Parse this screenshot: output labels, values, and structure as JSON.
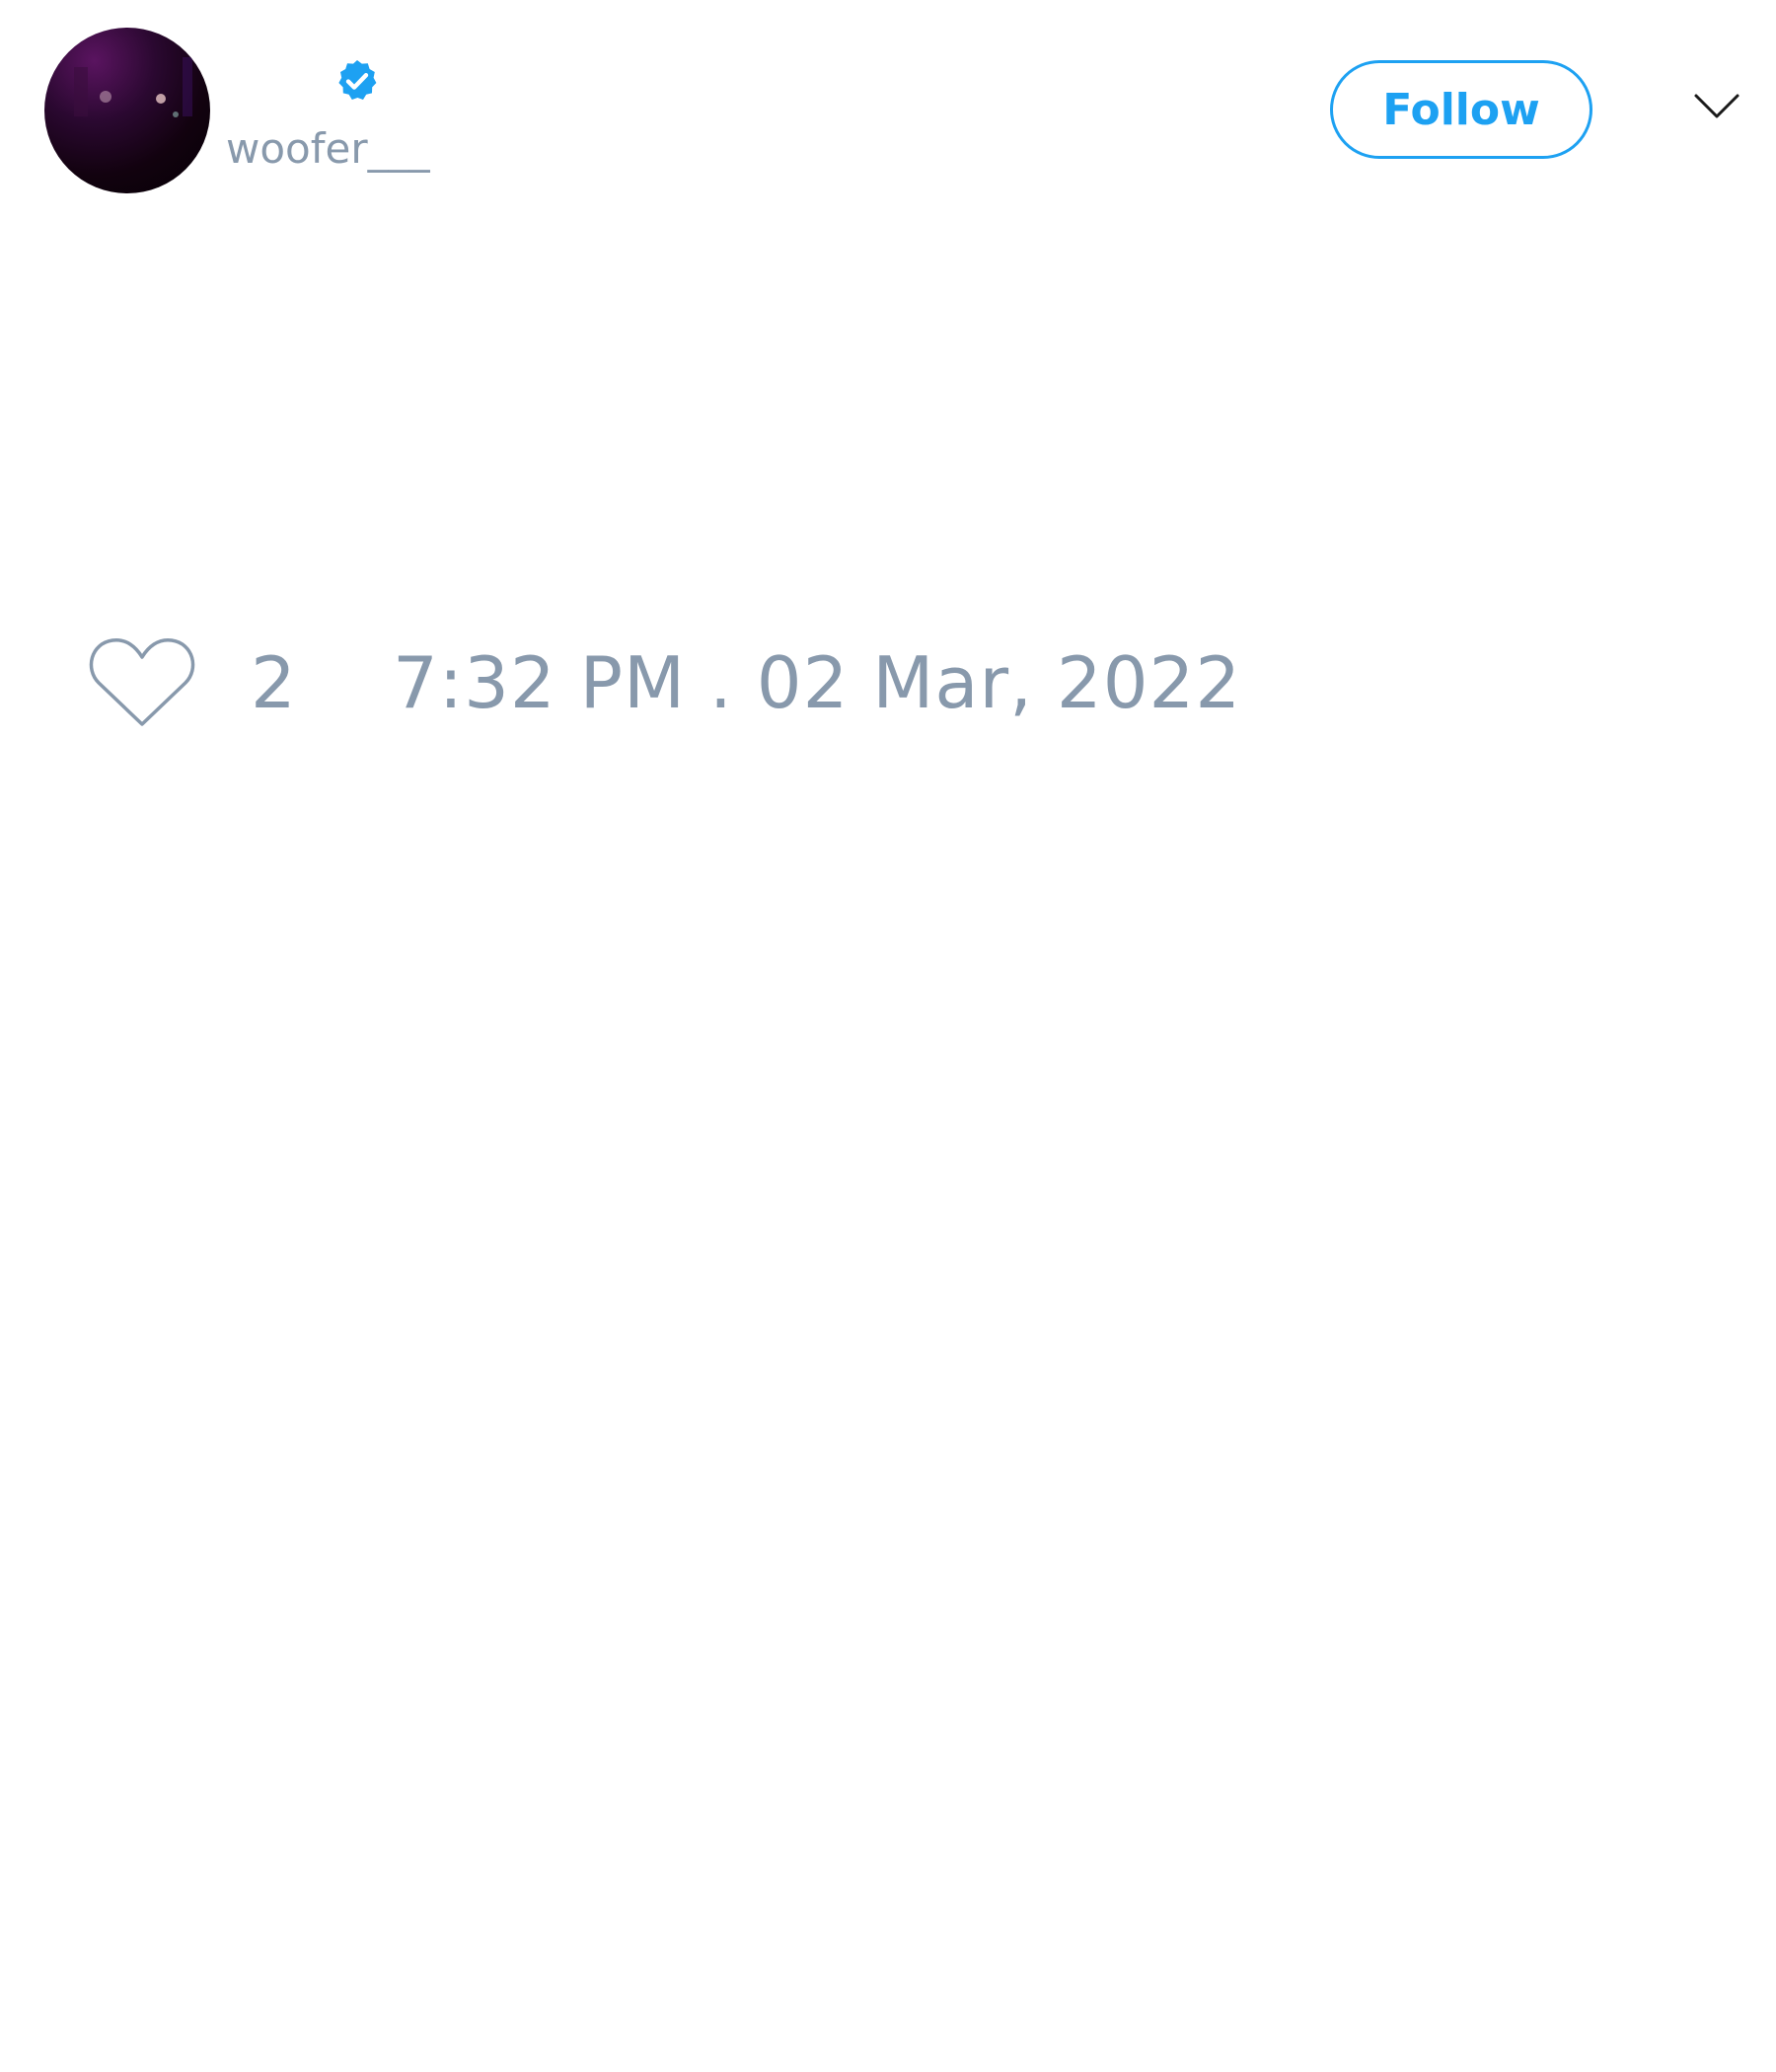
{
  "author": {
    "display_name": "",
    "handle": "woofer___",
    "verified": true,
    "avatar_icon": "avatar-photo"
  },
  "actions": {
    "follow_label": "Follow",
    "menu_icon": "chevron-down-icon"
  },
  "footer": {
    "like_icon": "heart-icon",
    "like_count": "2",
    "timestamp": "7:32 PM . 02 Mar, 2022"
  },
  "colors": {
    "accent": "#1da1f2",
    "muted_text": "#8899ac",
    "background": "#ffffff",
    "icon_dark": "#1a1a1a"
  }
}
